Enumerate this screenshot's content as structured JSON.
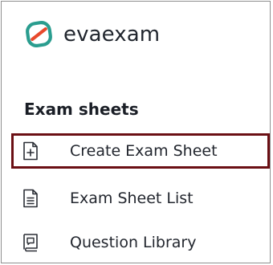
{
  "brand": {
    "name": "evaexam",
    "logo_icon": "evaexam-logo-icon",
    "accent_color": "#2a9d8f"
  },
  "section": {
    "title": "Exam sheets"
  },
  "nav": {
    "items": [
      {
        "label": "Create Exam Sheet",
        "icon": "add-document-icon",
        "active": true
      },
      {
        "label": "Exam Sheet List",
        "icon": "document-list-icon",
        "active": false
      },
      {
        "label": "Question Library",
        "icon": "question-library-icon",
        "active": false
      }
    ],
    "active_border_color": "#6b0f14"
  }
}
